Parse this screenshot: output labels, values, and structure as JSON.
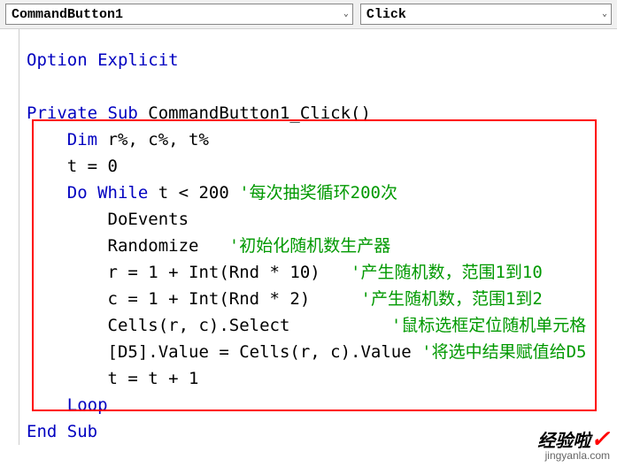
{
  "toolbar": {
    "object_selector": "CommandButton1",
    "procedure_selector": "Click"
  },
  "code": {
    "l1_kw": "Option Explicit",
    "l2_kw1": "Private Sub",
    "l2_name": " CommandButton1_Click()",
    "l3_kw": "Dim",
    "l3_rest": " r%, c%, t%",
    "l4": "    t = 0",
    "l5_kw": "Do While",
    "l5_expr": " t < 200 ",
    "l5_cm": "'每次抽奖循环200次",
    "l6": "        DoEvents",
    "l7_a": "        Randomize   ",
    "l7_cm": "'初始化随机数生产器",
    "l8_a": "        r = 1 + Int(Rnd * 10)   ",
    "l8_cm": "'产生随机数，范围1到10",
    "l9_a": "        c = 1 + Int(Rnd * 2)     ",
    "l9_cm": "'产生随机数，范围1到2",
    "l10_a": "        Cells(r, c).Select          ",
    "l10_cm": "'鼠标选框定位随机单元格",
    "l11_a": "        [D5].Value = Cells(r, c).Value ",
    "l11_cm": "'将选中结果赋值给D5",
    "l12": "        t = t + 1",
    "l13_kw": "Loop",
    "l14_kw": "End Sub"
  },
  "watermark": {
    "brand": "经验啦",
    "check": "✓",
    "url": "jingyanla.com"
  }
}
